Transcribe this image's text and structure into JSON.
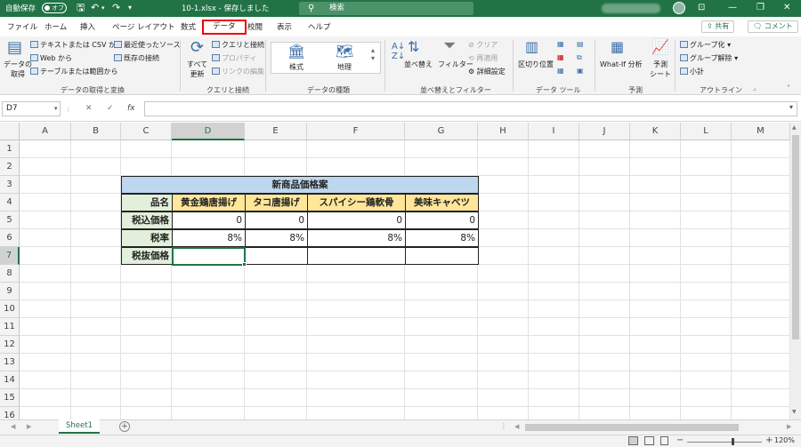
{
  "titlebar": {
    "autosave_label": "自動保存",
    "autosave_state": "オフ",
    "filename": "10-1.xlsx - 保存しました",
    "search_placeholder": "検索"
  },
  "ribbon_tabs": [
    "ファイル",
    "ホーム",
    "挿入",
    "ページ レイアウト",
    "数式",
    "データ",
    "校閲",
    "表示",
    "ヘルプ"
  ],
  "active_tab": "データ",
  "share_label": "共有",
  "comment_label": "コメント",
  "ribbon": {
    "get_data": "データの\n取得",
    "text_csv": "テキストまたは CSV から",
    "web": "Web から",
    "table_range": "テーブルまたは範囲から",
    "recent_sources": "最近使ったソース",
    "existing_conn": "既存の接続",
    "group_get": "データの取得と変換",
    "refresh_all": "すべて\n更新",
    "queries_conn": "クエリと接続",
    "properties": "プロパティ",
    "edit_links": "リンクの編集",
    "group_queries": "クエリと接続",
    "stocks": "株式",
    "geography": "地理",
    "group_datatypes": "データの種類",
    "sort": "並べ替え",
    "filter": "フィルター",
    "clear": "クリア",
    "reapply": "再適用",
    "advanced": "詳細設定",
    "group_sort": "並べ替えとフィルター",
    "text_to_columns": "区切り位置",
    "group_datatools": "データ ツール",
    "whatif": "What-If 分析",
    "forecast_sheet": "予測\nシート",
    "group_forecast": "予測",
    "group_btn": "グループ化",
    "ungroup_btn": "グループ解除",
    "subtotal": "小計",
    "group_outline": "アウトライン"
  },
  "formula_bar": {
    "name_box": "D7",
    "cancel": "✕",
    "enter": "✓",
    "fx": "fx",
    "value": ""
  },
  "columns": [
    "A",
    "B",
    "C",
    "D",
    "E",
    "F",
    "G",
    "H",
    "I",
    "J",
    "K",
    "L",
    "M"
  ],
  "rows": [
    "1",
    "2",
    "3",
    "4",
    "5",
    "6",
    "7",
    "8",
    "9",
    "10",
    "11",
    "12",
    "13",
    "14",
    "15",
    "16"
  ],
  "table": {
    "title": "新商品価格案",
    "header_label": "品名",
    "products": [
      "黄金鶏唐揚げ",
      "タコ唐揚げ",
      "スパイシー鶏軟骨",
      "美味キャベツ"
    ],
    "row_labels": [
      "税込価格",
      "税率",
      "税抜価格"
    ],
    "tax_included": [
      "0",
      "0",
      "0",
      "0"
    ],
    "tax_rate": [
      "8%",
      "8%",
      "8%",
      "8%"
    ],
    "tax_excluded": [
      "",
      "",
      "",
      ""
    ]
  },
  "sheets": [
    "Sheet1"
  ],
  "zoom": "120%"
}
